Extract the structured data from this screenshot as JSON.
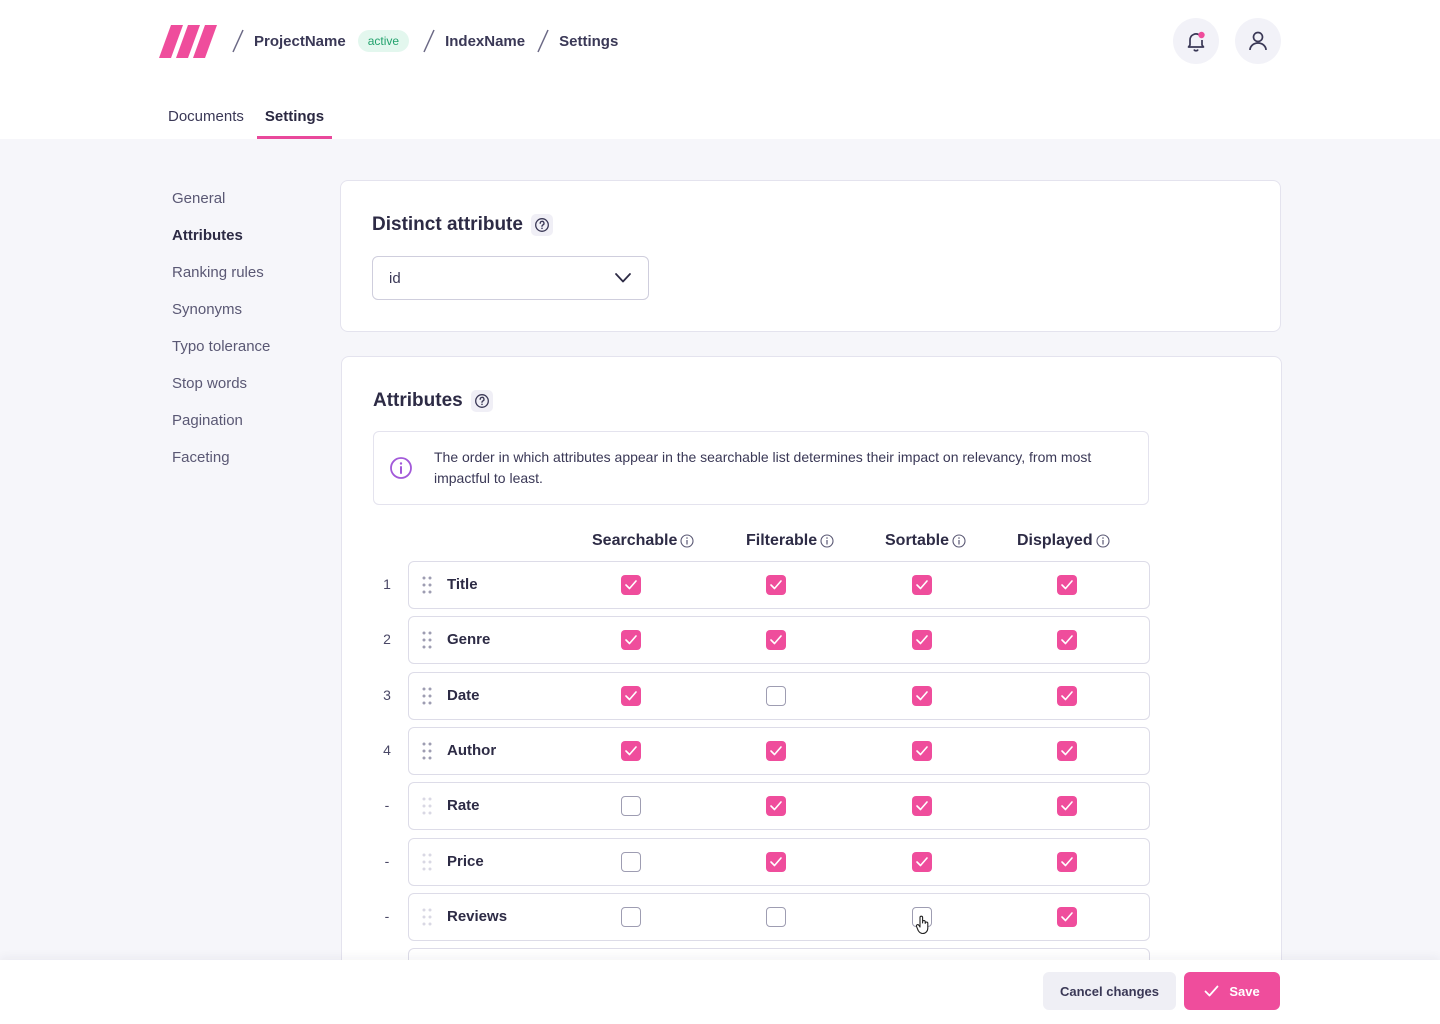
{
  "colors": {
    "accent": "#ef4d9c",
    "active_badge": "#23a26d",
    "text": "#2d2b45"
  },
  "header": {
    "breadcrumbs": {
      "project": "ProjectName",
      "status": "active",
      "index": "IndexName",
      "page": "Settings"
    },
    "icons": {
      "logo": "logo-icon",
      "notifications": "bell-icon",
      "profile": "user-icon"
    }
  },
  "tabs": [
    {
      "label": "Documents"
    },
    {
      "label": "Settings"
    }
  ],
  "sidebar": {
    "items": [
      {
        "label": "General"
      },
      {
        "label": "Attributes"
      },
      {
        "label": "Ranking rules"
      },
      {
        "label": "Synonyms"
      },
      {
        "label": "Typo tolerance"
      },
      {
        "label": "Stop words"
      },
      {
        "label": "Pagination"
      },
      {
        "label": "Faceting"
      }
    ]
  },
  "distinct": {
    "title": "Distinct attribute",
    "selected": "id"
  },
  "attributes": {
    "title": "Attributes",
    "info": "The order in which attributes appear in the searchable list determines their impact on relevancy, from most impactful to least.",
    "columns": [
      {
        "label": "Searchable"
      },
      {
        "label": "Filterable"
      },
      {
        "label": "Sortable"
      },
      {
        "label": "Displayed"
      }
    ],
    "rows": [
      {
        "rank": "1",
        "name": "Title",
        "checks": [
          true,
          true,
          true,
          true
        ]
      },
      {
        "rank": "2",
        "name": "Genre",
        "checks": [
          true,
          true,
          true,
          true
        ]
      },
      {
        "rank": "3",
        "name": "Date",
        "checks": [
          true,
          false,
          true,
          true
        ]
      },
      {
        "rank": "4",
        "name": "Author",
        "checks": [
          true,
          true,
          true,
          true
        ]
      },
      {
        "rank": "-",
        "name": "Rate",
        "checks": [
          false,
          true,
          true,
          true
        ]
      },
      {
        "rank": "-",
        "name": "Price",
        "checks": [
          false,
          true,
          true,
          true
        ]
      },
      {
        "rank": "-",
        "name": "Reviews",
        "checks": [
          false,
          false,
          false,
          true
        ]
      }
    ]
  },
  "footer": {
    "cancel_label": "Cancel changes",
    "save_label": "Save"
  }
}
